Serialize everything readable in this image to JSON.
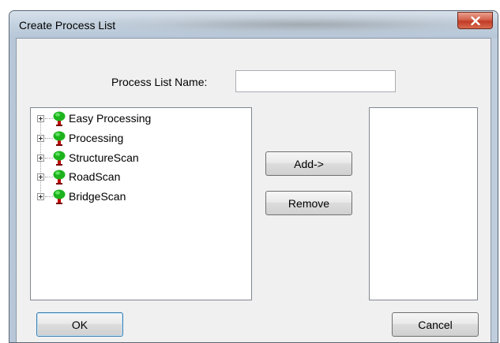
{
  "window": {
    "title": "Create Process List"
  },
  "form": {
    "name_label": "Process List Name:",
    "name_value": "",
    "name_placeholder": ""
  },
  "tree": {
    "items": [
      {
        "label": "Easy Processing"
      },
      {
        "label": "Processing"
      },
      {
        "label": "StructureScan"
      },
      {
        "label": "RoadScan"
      },
      {
        "label": "BridgeScan"
      }
    ]
  },
  "buttons": {
    "add": "Add->",
    "remove": "Remove",
    "ok": "OK",
    "cancel": "Cancel"
  },
  "icons": {
    "tree_item": "tree-icon",
    "close": "close-icon"
  },
  "colors": {
    "close_button": "#c13b25",
    "tree_foliage": "#1db31d",
    "tree_trunk": "#c00000"
  }
}
